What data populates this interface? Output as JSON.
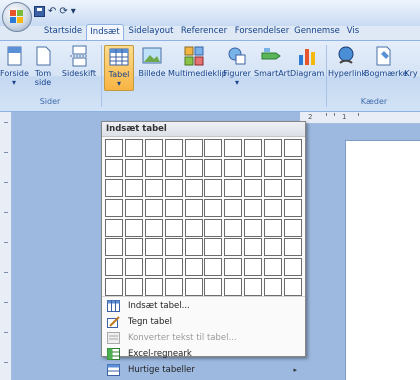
{
  "quick_access": {
    "undo_glyph": "↶",
    "redo_glyph": "⟳",
    "dropdown_glyph": "▾"
  },
  "tabs": [
    "Startside",
    "Indsæt",
    "Sidelayout",
    "Referencer",
    "Forsendelser",
    "Gennemse",
    "Vis"
  ],
  "active_tab": "Indsæt",
  "ribbon": {
    "buttons": [
      {
        "label": "Forside",
        "icon": "cover-page-icon"
      },
      {
        "label": "Tom\nside",
        "icon": "blank-page-icon"
      },
      {
        "label": "Sideskift",
        "icon": "page-break-icon"
      },
      {
        "label": "Tabel",
        "icon": "table-icon"
      },
      {
        "label": "Billede",
        "icon": "picture-icon"
      },
      {
        "label": "Multimedieklip",
        "icon": "clip-art-icon"
      },
      {
        "label": "Figurer",
        "icon": "shapes-icon"
      },
      {
        "label": "SmartArt",
        "icon": "smartart-icon"
      },
      {
        "label": "Diagram",
        "icon": "chart-icon"
      },
      {
        "label": "Hyperlink",
        "icon": "hyperlink-icon"
      },
      {
        "label": "Bogmærke",
        "icon": "bookmark-icon"
      },
      {
        "label": "Kry",
        "icon": "cross-reference-icon"
      }
    ],
    "groups": {
      "sider": "Sider",
      "kaeder": "Kæder"
    },
    "dropdown_glyph": "▾"
  },
  "table_dropdown": {
    "header": "Indsæt tabel",
    "grid": {
      "rows": 8,
      "cols": 10
    },
    "menu_items": [
      {
        "label": "Indsæt tabel...",
        "icon": "insert-table-icon",
        "enabled": true
      },
      {
        "label": "Tegn tabel",
        "icon": "draw-table-icon",
        "enabled": true
      },
      {
        "label": "Konverter tekst til tabel...",
        "icon": "convert-text-icon",
        "enabled": false
      },
      {
        "label": "Excel-regneark",
        "icon": "excel-icon",
        "enabled": true
      },
      {
        "label": "Hurtige tabeller",
        "icon": "quick-tables-icon",
        "enabled": true,
        "submenu_glyph": "▸"
      }
    ]
  },
  "ruler": {
    "labels": [
      "2",
      "1"
    ]
  },
  "colors": {
    "accent": "#15428b",
    "ribbon_bg": "#dbe7f7",
    "pressed": "#f8b444",
    "doc_bg": "#9db9e0"
  }
}
